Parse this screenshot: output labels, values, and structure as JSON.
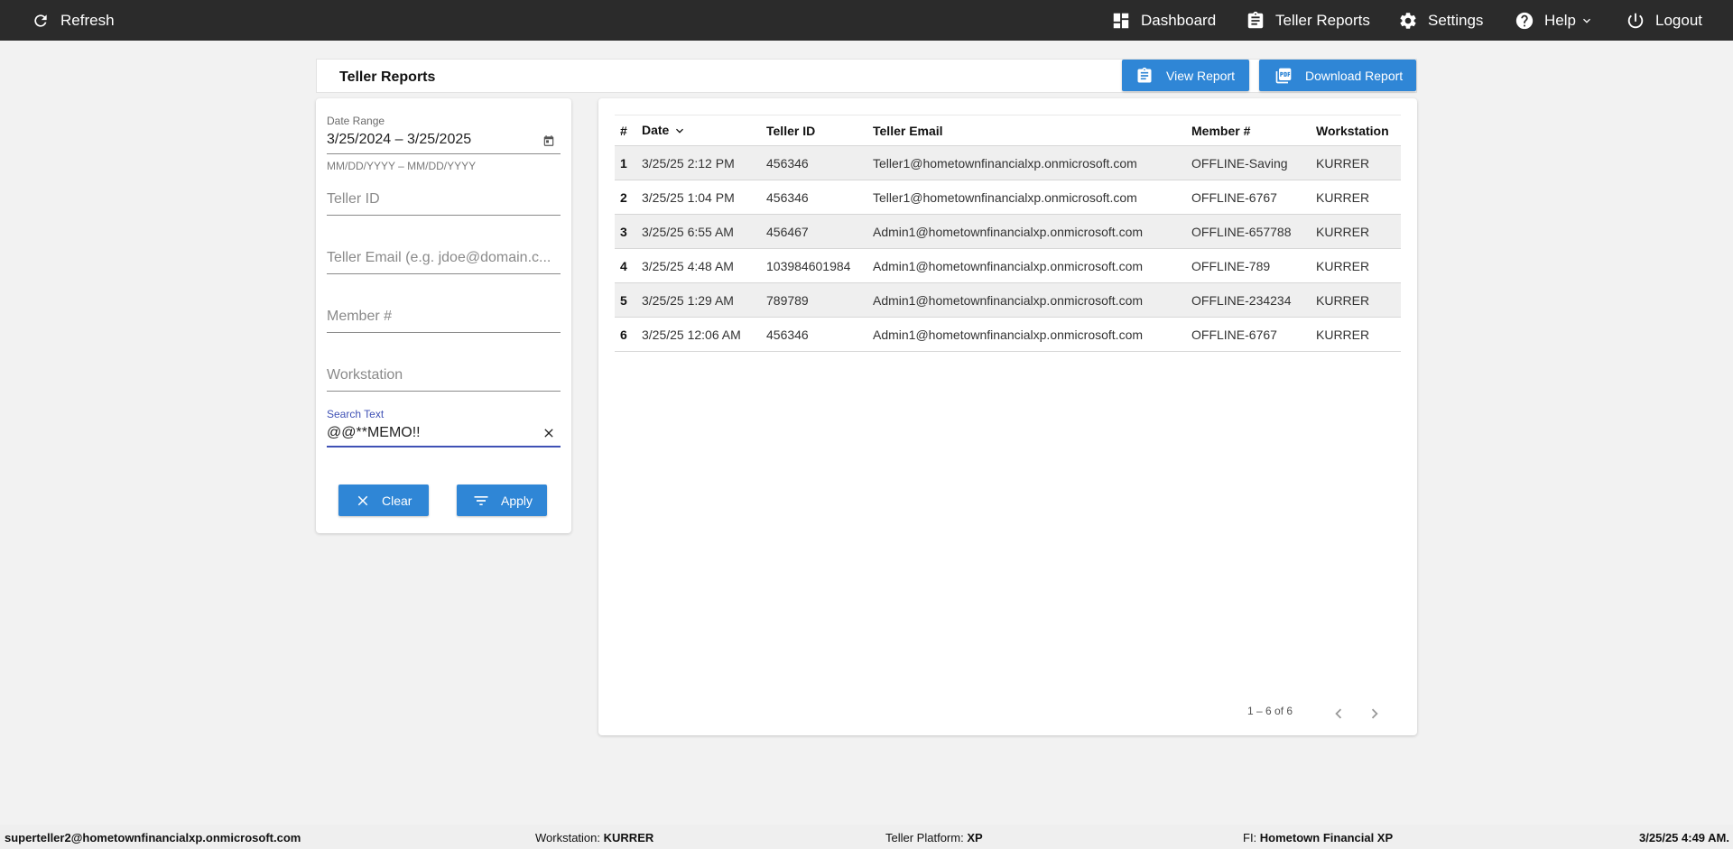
{
  "topbar": {
    "refresh_label": "Refresh",
    "dashboard_label": "Dashboard",
    "teller_reports_label": "Teller Reports",
    "settings_label": "Settings",
    "help_label": "Help",
    "logout_label": "Logout"
  },
  "header": {
    "title": "Teller Reports",
    "view_report_label": "View Report",
    "download_report_label": "Download Report"
  },
  "filters": {
    "date_range_label": "Date Range",
    "date_range_value": "3/25/2024 – 3/25/2025",
    "date_range_hint": "MM/DD/YYYY – MM/DD/YYYY",
    "teller_id_placeholder": "Teller ID",
    "teller_email_placeholder": "Teller Email (e.g. jdoe@domain.c...",
    "member_placeholder": "Member #",
    "workstation_placeholder": "Workstation",
    "search_label": "Search Text",
    "search_value": "@@**MEMO!!",
    "clear_label": "Clear",
    "apply_label": "Apply",
    "accent_color": "#3f51b5"
  },
  "table": {
    "columns": [
      "#",
      "Date",
      "Teller ID",
      "Teller Email",
      "Member #",
      "Workstation"
    ],
    "rows": [
      [
        "1",
        "3/25/25 2:12 PM",
        "456346",
        "Teller1@hometownfinancialxp.onmicrosoft.com",
        "OFFLINE-Saving",
        "KURRER"
      ],
      [
        "2",
        "3/25/25 1:04 PM",
        "456346",
        "Teller1@hometownfinancialxp.onmicrosoft.com",
        "OFFLINE-6767",
        "KURRER"
      ],
      [
        "3",
        "3/25/25 6:55 AM",
        "456467",
        "Admin1@hometownfinancialxp.onmicrosoft.com",
        "OFFLINE-657788",
        "KURRER"
      ],
      [
        "4",
        "3/25/25 4:48 AM",
        "103984601984",
        "Admin1@hometownfinancialxp.onmicrosoft.com",
        "OFFLINE-789",
        "KURRER"
      ],
      [
        "5",
        "3/25/25 1:29 AM",
        "789789",
        "Admin1@hometownfinancialxp.onmicrosoft.com",
        "OFFLINE-234234",
        "KURRER"
      ],
      [
        "6",
        "3/25/25 12:06 AM",
        "456346",
        "Admin1@hometownfinancialxp.onmicrosoft.com",
        "OFFLINE-6767",
        "KURRER"
      ]
    ],
    "pager_text": "1 – 6 of 6"
  },
  "footer": {
    "user_email": "superteller2@hometownfinancialxp.onmicrosoft.com",
    "workstation_label": "Workstation:",
    "workstation_value": "KURRER",
    "platform_label": "Teller Platform:",
    "platform_value": "XP",
    "fi_label": "FI:",
    "fi_value": "Hometown Financial XP",
    "datetime": "3/25/25 4:49 AM."
  },
  "colors": {
    "topbar_bg": "#2b2b2b",
    "primary_button": "#2f86d6",
    "page_bg": "#f2f2f2"
  }
}
